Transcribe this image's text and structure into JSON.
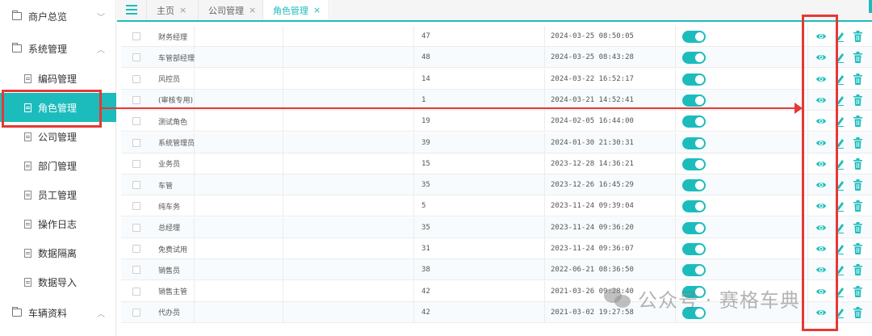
{
  "sidebar": {
    "groups": [
      {
        "label": "商户总览",
        "chevron": "chevron-down"
      },
      {
        "label": "系统管理",
        "chevron": "chevron-up"
      },
      {
        "label": "车辆资料",
        "chevron": "chevron-up"
      }
    ],
    "sub_items": [
      {
        "label": "编码管理"
      },
      {
        "label": "角色管理",
        "active": true
      },
      {
        "label": "公司管理"
      },
      {
        "label": "部门管理"
      },
      {
        "label": "员工管理"
      },
      {
        "label": "操作日志"
      },
      {
        "label": "数据隔离"
      },
      {
        "label": "数据导入"
      }
    ]
  },
  "tabs": [
    {
      "label": "主页",
      "close": "×"
    },
    {
      "label": "公司管理",
      "close": "×"
    },
    {
      "label": "角色管理",
      "close": "×",
      "active": true
    }
  ],
  "table": {
    "rows": [
      {
        "name": "财务经理",
        "count": "47",
        "time": "2024-03-25 08:50:05",
        "enabled": true
      },
      {
        "name": "车管部经理",
        "count": "48",
        "time": "2024-03-25 08:43:28",
        "enabled": true
      },
      {
        "name": "风控员",
        "count": "14",
        "time": "2024-03-22 16:52:17",
        "enabled": true
      },
      {
        "name": "(审核专用)",
        "count": "1",
        "time": "2024-03-21 14:52:41",
        "enabled": true
      },
      {
        "name": "测试角色",
        "count": "19",
        "time": "2024-02-05 16:44:00",
        "enabled": true
      },
      {
        "name": "系统管理员",
        "count": "39",
        "time": "2024-01-30 21:30:31",
        "enabled": true
      },
      {
        "name": "业务员",
        "count": "15",
        "time": "2023-12-28 14:36:21",
        "enabled": true
      },
      {
        "name": "车管",
        "count": "35",
        "time": "2023-12-26 16:45:29",
        "enabled": true
      },
      {
        "name": "纯车务",
        "count": "5",
        "time": "2023-11-24 09:39:04",
        "enabled": true
      },
      {
        "name": "总经理",
        "count": "35",
        "time": "2023-11-24 09:36:20",
        "enabled": true
      },
      {
        "name": "免费试用",
        "count": "31",
        "time": "2023-11-24 09:36:07",
        "enabled": true
      },
      {
        "name": "销售员",
        "count": "38",
        "time": "2022-06-21 08:36:50",
        "enabled": true
      },
      {
        "name": "销售主管",
        "count": "42",
        "time": "2021-03-26 09:28:40",
        "enabled": true
      },
      {
        "name": "代办员",
        "count": "42",
        "time": "2021-03-02 19:27:58",
        "enabled": true
      }
    ]
  },
  "watermark": {
    "text": "公众号 · 赛格车典"
  },
  "colors": {
    "accent": "#1dbcbc",
    "annotation": "#e53935"
  }
}
